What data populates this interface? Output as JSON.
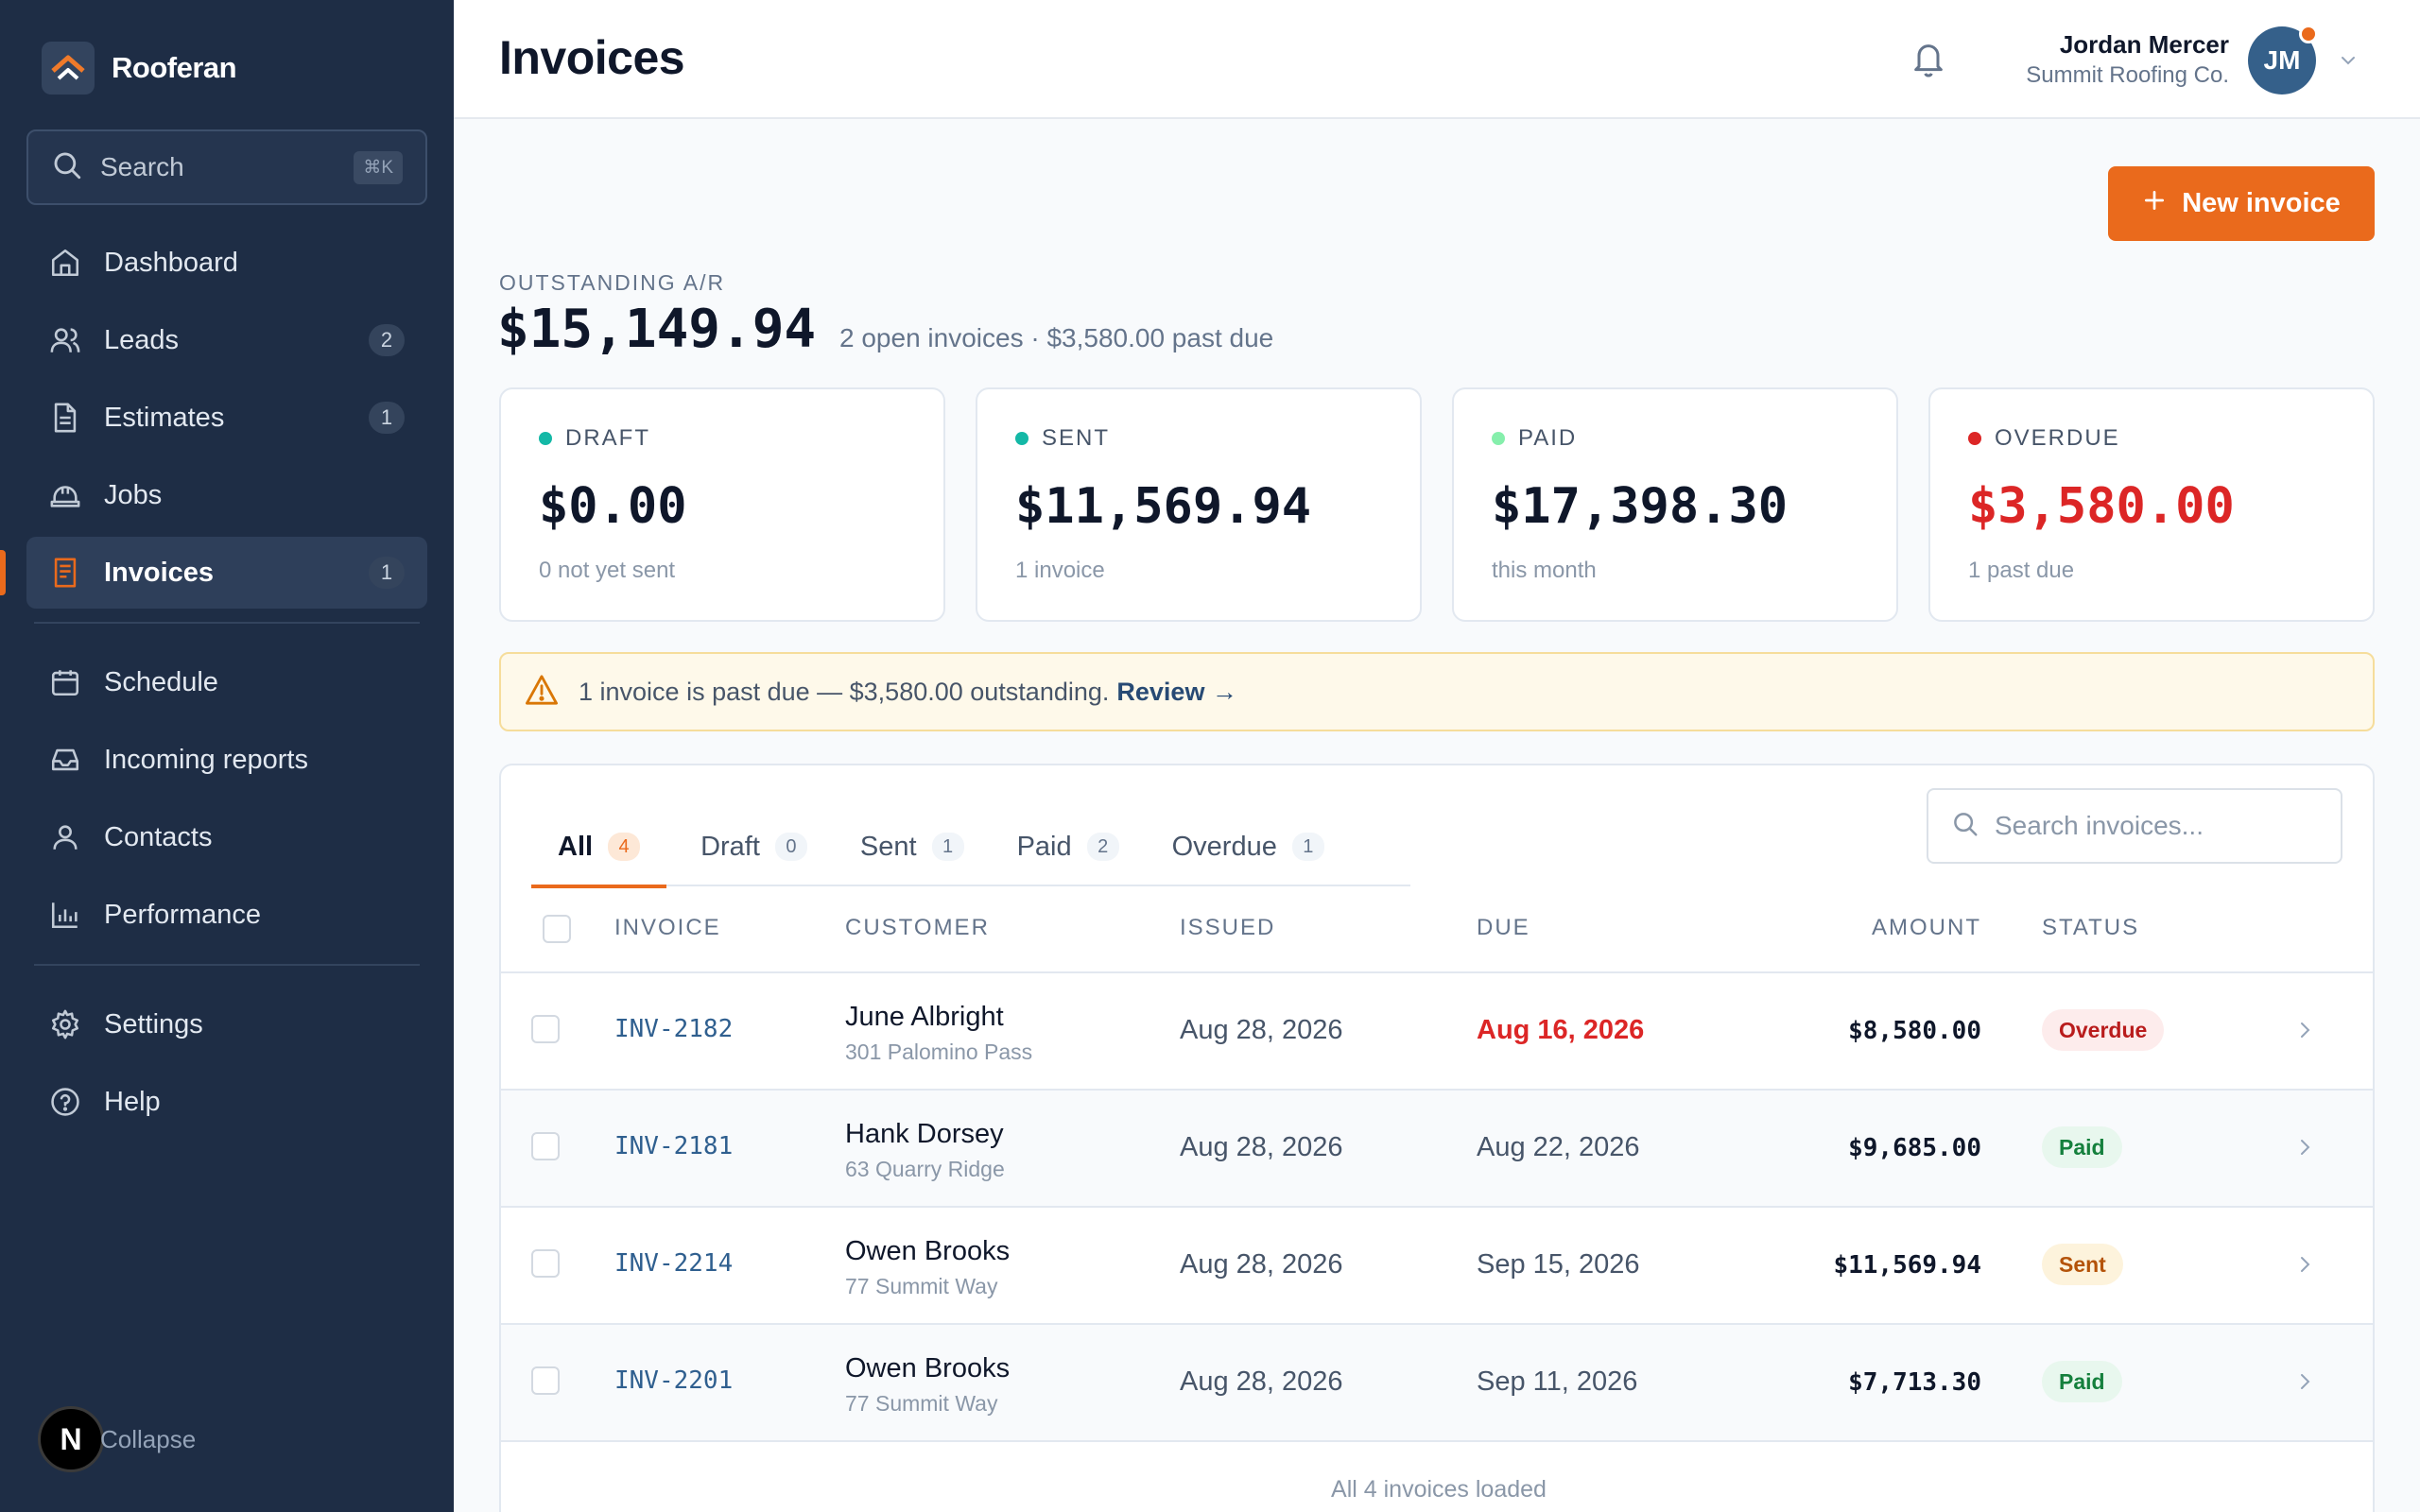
{
  "colors": {
    "accent": "#ea6a1c",
    "sidebar_bg": "#1e2d45",
    "overdue": "#dc2626",
    "paid": "#15803d",
    "sent": "#b45309",
    "draft_dot": "#14b8a6",
    "sent_dot": "#14b8a6",
    "paid_dot": "#86efac",
    "overdue_dot": "#dc2626"
  },
  "brand": {
    "name": "Rooferan",
    "icon": "roof-chevron-icon"
  },
  "sidebar": {
    "search_label": "Search",
    "search_shortcut": "⌘K",
    "nav_primary": [
      {
        "label": "Dashboard",
        "icon": "home-icon"
      },
      {
        "label": "Leads",
        "icon": "users-icon",
        "count": "2"
      },
      {
        "label": "Estimates",
        "icon": "document-icon",
        "count": "1"
      },
      {
        "label": "Jobs",
        "icon": "hardhat-icon"
      },
      {
        "label": "Invoices",
        "icon": "receipt-icon",
        "count": "1",
        "active": true
      }
    ],
    "nav_secondary": [
      {
        "label": "Schedule",
        "icon": "calendar-icon"
      },
      {
        "label": "Incoming reports",
        "icon": "inbox-icon"
      },
      {
        "label": "Contacts",
        "icon": "user-icon"
      },
      {
        "label": "Performance",
        "icon": "bar-chart-icon"
      }
    ],
    "nav_tertiary": [
      {
        "label": "Settings",
        "icon": "gear-icon"
      },
      {
        "label": "Help",
        "icon": "help-circle-icon"
      }
    ],
    "collapse_badge": "N",
    "collapse_label": "Collapse"
  },
  "header": {
    "title": "Invoices",
    "user_name": "Jordan Mercer",
    "user_org": "Summit Roofing Co.",
    "avatar_initials": "JM"
  },
  "main": {
    "new_invoice_label": "New invoice",
    "ar_label": "OUTSTANDING A/R",
    "ar_amount": "$15,149.94",
    "ar_sub": "2 open invoices · $3,580.00 past due",
    "cards": [
      {
        "label": "DRAFT",
        "value": "$0.00",
        "sub": "0 not yet sent"
      },
      {
        "label": "SENT",
        "value": "$11,569.94",
        "sub": "1 invoice"
      },
      {
        "label": "PAID",
        "value": "$17,398.30",
        "sub": "this month"
      },
      {
        "label": "OVERDUE",
        "value": "$3,580.00",
        "sub": "1 past due"
      }
    ],
    "alert": {
      "message": "1 invoice is past due — $3,580.00 outstanding.",
      "link": "Review →"
    },
    "tabs": [
      {
        "label": "All",
        "count": "4"
      },
      {
        "label": "Draft",
        "count": "0"
      },
      {
        "label": "Sent",
        "count": "1"
      },
      {
        "label": "Paid",
        "count": "2"
      },
      {
        "label": "Overdue",
        "count": "1"
      }
    ],
    "table_search_placeholder": "Search invoices...",
    "columns": [
      "INVOICE",
      "CUSTOMER",
      "ISSUED",
      "DUE",
      "AMOUNT",
      "STATUS"
    ],
    "rows": [
      {
        "invoice": "INV-2182",
        "customer": "June Albright",
        "address": "301 Palomino Pass",
        "issued": "Aug 28, 2026",
        "due": "Aug 16, 2026",
        "amount": "$8,580.00",
        "status": "Overdue"
      },
      {
        "invoice": "INV-2181",
        "customer": "Hank Dorsey",
        "address": "63 Quarry Ridge",
        "issued": "Aug 28, 2026",
        "due": "Aug 22, 2026",
        "amount": "$9,685.00",
        "status": "Paid"
      },
      {
        "invoice": "INV-2214",
        "customer": "Owen Brooks",
        "address": "77 Summit Way",
        "issued": "Aug 28, 2026",
        "due": "Sep 15, 2026",
        "amount": "$11,569.94",
        "status": "Sent"
      },
      {
        "invoice": "INV-2201",
        "customer": "Owen Brooks",
        "address": "77 Summit Way",
        "issued": "Aug 28, 2026",
        "due": "Sep 11, 2026",
        "amount": "$7,713.30",
        "status": "Paid"
      }
    ],
    "footer_note": "All 4 invoices loaded"
  }
}
